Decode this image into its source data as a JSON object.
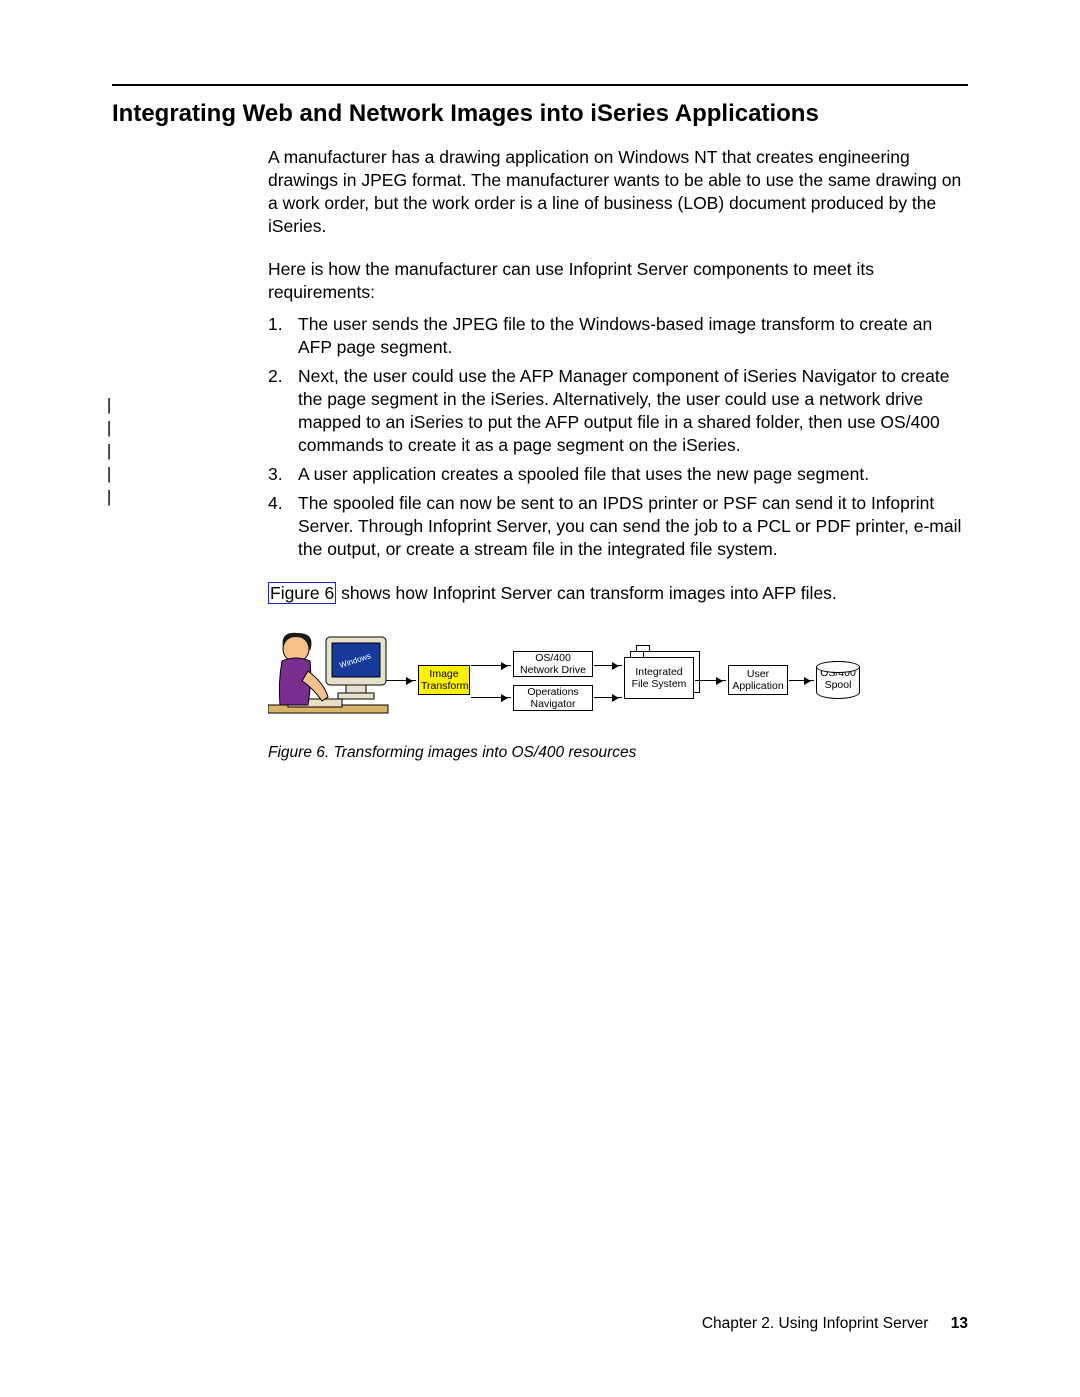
{
  "heading": "Integrating Web and Network Images into iSeries Applications",
  "para1": "A manufacturer has a drawing application on Windows NT that creates engineering drawings in JPEG format. The manufacturer wants to be able to use the same drawing on a work order, but the work order is a line of business (LOB) document produced by the iSeries.",
  "para2": "Here is how the manufacturer can use Infoprint Server components to meet its requirements:",
  "steps": [
    "The user sends the JPEG file to the Windows-based image transform to create an AFP page segment.",
    "Next, the user could use the AFP Manager component of iSeries Navigator to create the page segment in the iSeries. Alternatively, the user could use a network drive mapped to an iSeries to put the AFP output file in a shared folder, then use OS/400 commands to create it as a page segment on the iSeries.",
    "A user application creates a spooled file that uses the new page segment.",
    "The spooled file can now be sent to an IPDS printer or PSF can send it to Infoprint Server. Through Infoprint Server, you can send the job to a PCL or PDF printer, e-mail the output, or create a stream file in the integrated file system."
  ],
  "para3_pre": "",
  "figlink": "Figure 6",
  "para3_post": " shows how Infoprint Server can transform images into AFP files.",
  "figcaption": "Figure 6. Transforming images into OS/400 resources",
  "diagram": {
    "monitor_label": "Windows",
    "image_transform_l1": "Image",
    "image_transform_l2": "Transform",
    "netdrive_l1": "OS/400",
    "netdrive_l2": "Network Drive",
    "opnav_l1": "Operations",
    "opnav_l2": "Navigator",
    "ifs_l1": "Integrated",
    "ifs_l2": "File System",
    "userapp_l1": "User",
    "userapp_l2": "Application",
    "spool_l1": "OS/400",
    "spool_l2": "Spool"
  },
  "footer_chapter": "Chapter 2. Using Infoprint Server",
  "footer_page": "13"
}
